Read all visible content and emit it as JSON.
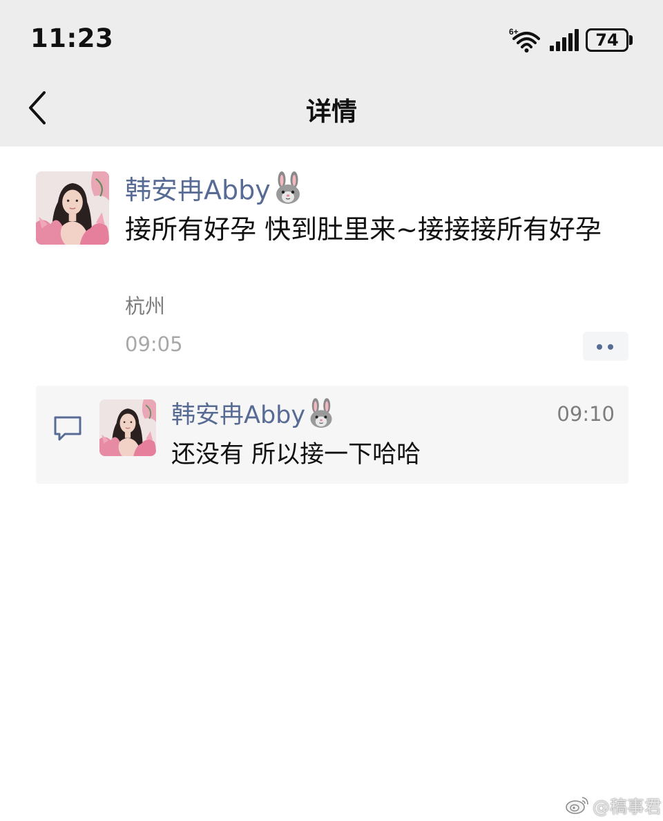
{
  "status_bar": {
    "time": "11:23",
    "network_label": "6+",
    "battery": "74",
    "icons": [
      "wifi-icon",
      "signal-icon",
      "battery-icon"
    ]
  },
  "nav": {
    "title": "详情",
    "back_icon": "chevron-left-icon"
  },
  "post": {
    "author": "韩安冉Abby",
    "author_emoji": "rabbit-face-icon",
    "content": "接所有好孕 快到肚里来~接接接所有好孕",
    "location": "杭州",
    "time": "09:05",
    "more_icon": "more-dots-icon"
  },
  "comment": {
    "icon": "comment-bubble-icon",
    "author": "韩安冉Abby",
    "time": "09:10",
    "text": "还没有 所以接一下哈哈"
  },
  "watermark": {
    "text": "@稿事君",
    "logo": "weibo-logo-icon"
  },
  "colors": {
    "link_blue": "#576b95",
    "header_bg": "#ededed",
    "comment_bg": "#f6f6f6",
    "location_gray": "#7d7d7d",
    "time_gray": "#a8a8a8"
  }
}
